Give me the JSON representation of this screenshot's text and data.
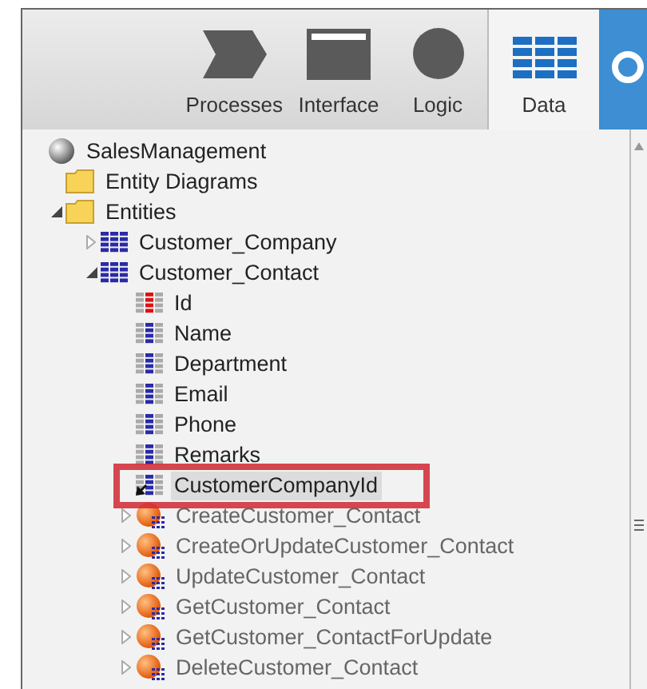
{
  "toolbar": {
    "tabs": [
      {
        "label": "Processes",
        "kind": "processes",
        "selected": false
      },
      {
        "label": "Interface",
        "kind": "interface",
        "selected": false
      },
      {
        "label": "Logic",
        "kind": "logic",
        "selected": false
      },
      {
        "label": "Data",
        "kind": "data",
        "selected": true
      }
    ]
  },
  "tree": [
    {
      "label": "SalesManagement",
      "kind": "module",
      "selected": false,
      "children": [
        {
          "label": "Entity Diagrams",
          "kind": "folder",
          "selected": false
        },
        {
          "label": "Entities",
          "kind": "folder",
          "expanded": true,
          "selected": false,
          "children": [
            {
              "label": "Customer_Company",
              "kind": "entity",
              "expanded": false,
              "selected": false
            },
            {
              "label": "Customer_Contact",
              "kind": "entity",
              "expanded": true,
              "selected": false,
              "children": [
                {
                  "label": "Id",
                  "kind": "identifier",
                  "selected": false
                },
                {
                  "label": "Name",
                  "kind": "attribute",
                  "selected": false
                },
                {
                  "label": "Department",
                  "kind": "attribute",
                  "selected": false
                },
                {
                  "label": "Email",
                  "kind": "attribute",
                  "selected": false
                },
                {
                  "label": "Phone",
                  "kind": "attribute",
                  "selected": false
                },
                {
                  "label": "Remarks",
                  "kind": "attribute",
                  "selected": false
                },
                {
                  "label": "CustomerCompanyId",
                  "kind": "reference",
                  "selected": true
                },
                {
                  "label": "CreateCustomer_Contact",
                  "kind": "action",
                  "expanded": false,
                  "selected": false
                },
                {
                  "label": "CreateOrUpdateCustomer_Contact",
                  "kind": "action",
                  "expanded": false,
                  "selected": false
                },
                {
                  "label": "UpdateCustomer_Contact",
                  "kind": "action",
                  "expanded": false,
                  "selected": false
                },
                {
                  "label": "GetCustomer_Contact",
                  "kind": "action",
                  "expanded": false,
                  "selected": false
                },
                {
                  "label": "GetCustomer_ContactForUpdate",
                  "kind": "action",
                  "expanded": false,
                  "selected": false
                },
                {
                  "label": "DeleteCustomer_Contact",
                  "kind": "action",
                  "expanded": false,
                  "selected": false
                }
              ]
            }
          ]
        }
      ]
    }
  ]
}
